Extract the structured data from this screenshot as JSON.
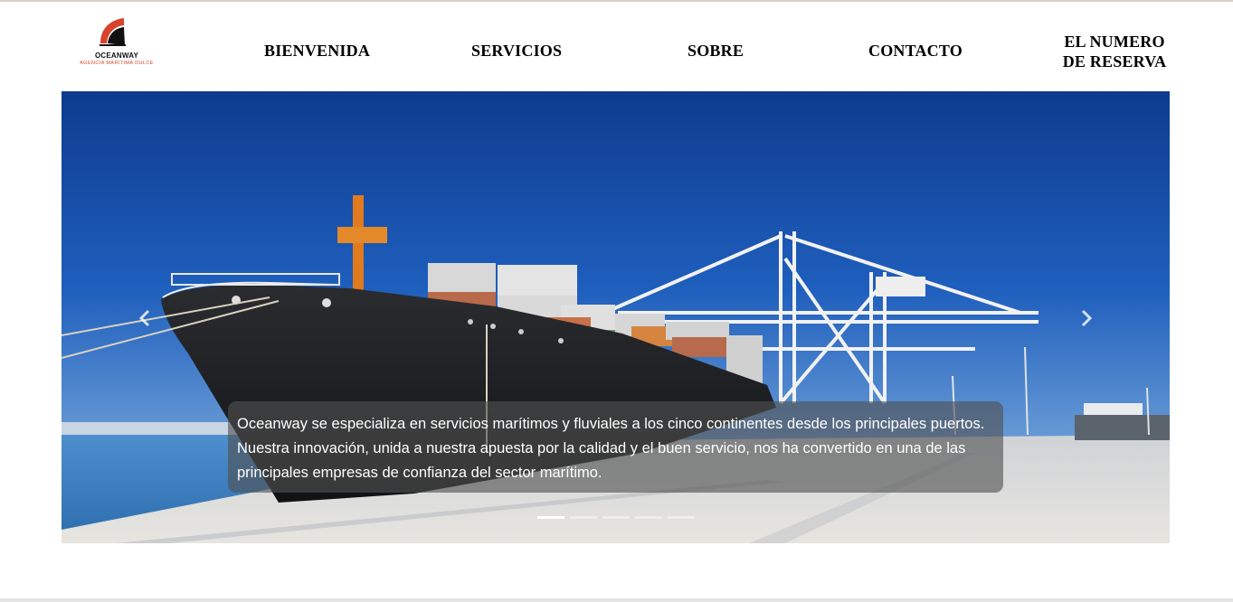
{
  "brand": {
    "name": "OCEANWAY",
    "tagline": "AGENCIA MARITIMA DULCE",
    "accent_color": "#d8432b"
  },
  "nav": {
    "items": [
      {
        "label": "BIENVENIDA"
      },
      {
        "label": "SERVICIOS"
      },
      {
        "label": "SOBRE"
      },
      {
        "label": "CONTACTO"
      },
      {
        "label": "EL NUMERO DE RESERVA"
      }
    ]
  },
  "carousel": {
    "caption": "Oceanway se especializa en servicios marítimos y fluviales a los cinco continentes desde los principales puertos. Nuestra innovación, unida a nuestra apuesta por la calidad y el buen servicio, nos ha convertido en una de las principales empresas de confianza del sector marítimo.",
    "prev_icon": "chevron-left-icon",
    "next_icon": "chevron-right-icon",
    "slide_count": 5,
    "active_slide": 1
  }
}
